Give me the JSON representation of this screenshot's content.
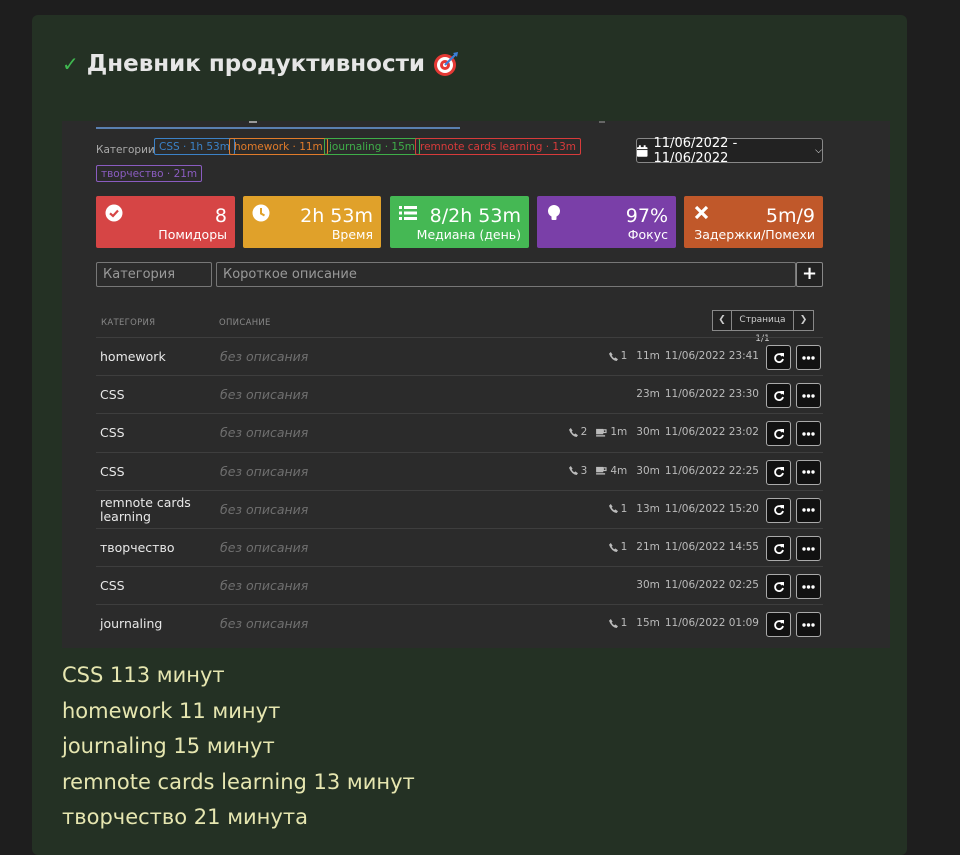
{
  "page": {
    "title": "Дневник продуктивности"
  },
  "categories": {
    "label": "Категории",
    "chips": [
      {
        "text": "CSS · 1h 53m",
        "color": "#3b82c8"
      },
      {
        "text": "homework · 11m",
        "color": "#e07b2a"
      },
      {
        "text": "journaling · 15m",
        "color": "#3fae49"
      },
      {
        "text": "remnote cards learning · 13m",
        "color": "#d83b3b"
      },
      {
        "text": "творчество · 21m",
        "color": "#8a5cc0"
      }
    ]
  },
  "date_range": "11/06/2022 - 11/06/2022",
  "stats": [
    {
      "value": "8",
      "label": "Помидоры",
      "color": "#d64545",
      "icon": "check-circle-icon"
    },
    {
      "value": "2h 53m",
      "label": "Время",
      "color": "#e0a12a",
      "icon": "clock-icon"
    },
    {
      "value": "8/2h 53m",
      "label": "Медиана (день)",
      "color": "#45b854",
      "icon": "list-icon"
    },
    {
      "value": "97%",
      "label": "Фокус",
      "color": "#7a3fa8",
      "icon": "lightbulb-icon"
    },
    {
      "value": "5m/9",
      "label": "Задержки/Помехи",
      "color": "#c0582a",
      "icon": "x-icon"
    }
  ],
  "form": {
    "category_placeholder": "Категория",
    "description_placeholder": "Короткое описание"
  },
  "table": {
    "headers": {
      "category": "КАТЕГОРИЯ",
      "description": "ОПИСАНИЕ"
    },
    "pager": "Страница 1/1",
    "rows": [
      {
        "category": "homework",
        "description": "без описания",
        "calls": "1",
        "breaks": "",
        "duration": "11m",
        "datetime": "11/06/2022 23:41"
      },
      {
        "category": "CSS",
        "description": "без описания",
        "calls": "",
        "breaks": "",
        "duration": "23m",
        "datetime": "11/06/2022 23:30"
      },
      {
        "category": "CSS",
        "description": "без описания",
        "calls": "2",
        "breaks": "1m",
        "duration": "30m",
        "datetime": "11/06/2022 23:02"
      },
      {
        "category": "CSS",
        "description": "без описания",
        "calls": "3",
        "breaks": "4m",
        "duration": "30m",
        "datetime": "11/06/2022 22:25"
      },
      {
        "category": "remnote cards learning",
        "description": "без описания",
        "calls": "1",
        "breaks": "",
        "duration": "13m",
        "datetime": "11/06/2022 15:20"
      },
      {
        "category": "творчество",
        "description": "без описания",
        "calls": "1",
        "breaks": "",
        "duration": "21m",
        "datetime": "11/06/2022 14:55"
      },
      {
        "category": "CSS",
        "description": "без описания",
        "calls": "",
        "breaks": "",
        "duration": "30m",
        "datetime": "11/06/2022 02:25"
      },
      {
        "category": "journaling",
        "description": "без описания",
        "calls": "1",
        "breaks": "",
        "duration": "15m",
        "datetime": "11/06/2022 01:09"
      }
    ]
  },
  "summary": [
    "CSS 113 минут",
    "homework 11 минут",
    "journaling 15 минут",
    "remnote cards learning 13 минут",
    "творчество 21 минута"
  ]
}
